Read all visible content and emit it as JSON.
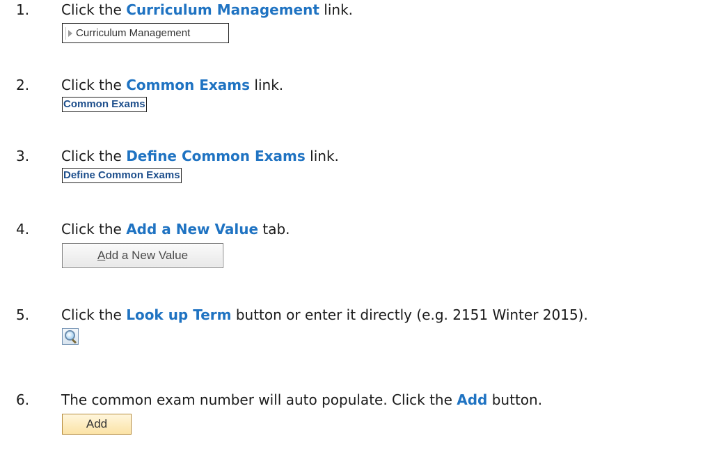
{
  "steps": [
    {
      "number": "1.",
      "pre": "Click the ",
      "highlight": "Curriculum Management",
      "post": " link.",
      "screenshot_label": "Curriculum Management"
    },
    {
      "number": "2.",
      "pre": "Click the ",
      "highlight": "Common Exams",
      "post": " link.",
      "screenshot_label": "Common Exams"
    },
    {
      "number": "3.",
      "pre": "Click the ",
      "highlight": "Define Common Exams",
      "post": " link.",
      "screenshot_label": "Define Common Exams"
    },
    {
      "number": "4.",
      "pre": "Click the ",
      "highlight": "Add a New Value",
      "post": " tab.",
      "screenshot_label_first": "A",
      "screenshot_label_rest": "dd a New Value"
    },
    {
      "number": "5.",
      "pre": "Click the ",
      "highlight": "Look up Term",
      "post": " button or enter it directly (e.g. 2151 Winter 2015).",
      "screenshot_icon": "magnifier-lookup-icon"
    },
    {
      "number": "6.",
      "pre": "The common exam number will auto populate. Click the ",
      "highlight": "Add",
      "post": " button.",
      "screenshot_label": "Add"
    }
  ],
  "colors": {
    "highlight": "#1f73c2",
    "link": "#1e4f8c",
    "add_button": "#fbe3a6"
  }
}
